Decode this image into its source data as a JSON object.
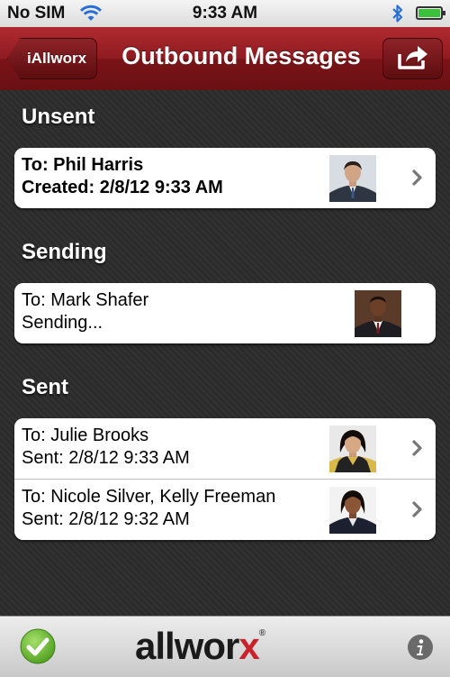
{
  "status_bar": {
    "carrier": "No SIM",
    "time": "9:33 AM",
    "battery_level": 1.0
  },
  "nav": {
    "back_label": "iAllworx",
    "title": "Outbound Messages",
    "share_icon": "share-icon"
  },
  "sections": {
    "unsent": {
      "title": "Unsent",
      "rows": [
        {
          "line1": "To: Phil Harris",
          "line2": "Created: 2/8/12 9:33 AM"
        }
      ]
    },
    "sending": {
      "title": "Sending",
      "rows": [
        {
          "line1": "To: Mark Shafer",
          "line2": "Sending..."
        }
      ]
    },
    "sent": {
      "title": "Sent",
      "rows": [
        {
          "line1": "To: Julie Brooks",
          "line2": "Sent: 2/8/12 9:33 AM"
        },
        {
          "line1": "To: Nicole Silver, Kelly Freeman",
          "line2": "Sent: 2/8/12 9:32 AM"
        }
      ]
    }
  },
  "bottom": {
    "logo_prefix": "allwor",
    "logo_x": "x",
    "logo_reg": "®"
  },
  "colors": {
    "nav_red": "#8e1b20",
    "logo_red": "#c8232c",
    "check_green": "#6cc230"
  }
}
